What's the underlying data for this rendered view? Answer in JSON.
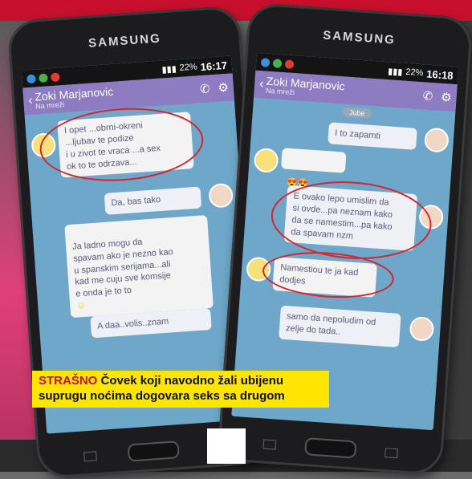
{
  "left_phone": {
    "brand": "SAMSUNG",
    "status_time": "16:17",
    "battery": "22%",
    "contact_name": "Zoki Marjanovic",
    "contact_status": "Na mreži",
    "messages": [
      {
        "dir": "in",
        "text": "I opet ...obrni-okreni\n...ljubav te podize\ni u zivot te vraca ...a sex\nok to te odrzava..."
      },
      {
        "dir": "out",
        "text": "Da, bas tako"
      },
      {
        "dir": "in",
        "text": "Ja ladno mogu da\nspavam ako je nezno kao\nu spanskim serijama...ali\nkad me cuju sve komsije\ne onda je  to to"
      },
      {
        "dir": "out",
        "text": "A daa..volis..znam"
      }
    ]
  },
  "right_phone": {
    "brand": "SAMSUNG",
    "status_time": "16:18",
    "battery": "22%",
    "contact_name": "Zoki Marjanovic",
    "contact_status": "Na mreži",
    "date_label": "Jube",
    "messages": [
      {
        "dir": "out",
        "text": "I to zapamti"
      },
      {
        "dir": "in",
        "text": ""
      },
      {
        "dir": "out",
        "text": "E ovako lepo umislim da\nsi ovde...pa neznam kako\nda se namestim...pa kako\nda spavam nzm"
      },
      {
        "dir": "in",
        "text": "Namestiou te ja kad\ndodjes"
      },
      {
        "dir": "out",
        "text": "samo da nepoludim od\nzelje do tada.."
      }
    ]
  },
  "caption": {
    "kicker": "STRAŠNO",
    "text": " Čovek koji navodno žali ubijenu suprugu noćima dogovara seks sa drugom"
  },
  "colors": {
    "header": "#8e7cc3",
    "chat_bg": "#6ea7c9",
    "circle": "#d8232a",
    "caption_bg": "#ffe500",
    "banner": "#c8102e"
  }
}
